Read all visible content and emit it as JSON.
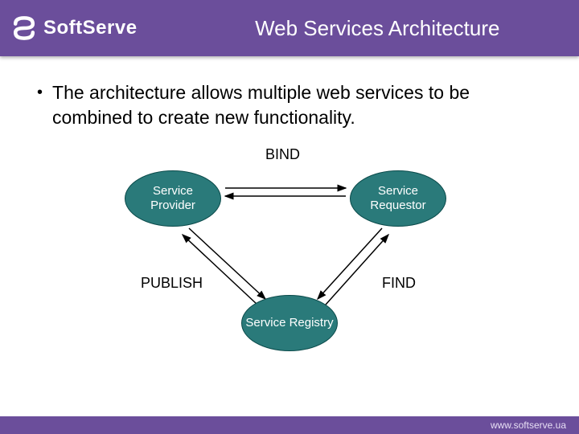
{
  "header": {
    "logo_text": "SoftServe",
    "title": "Web Services Architecture"
  },
  "content": {
    "bullet": "The architecture allows multiple web services to be combined to create new functionality."
  },
  "diagram": {
    "nodes": {
      "provider": "Service Provider",
      "requestor": "Service Requestor",
      "registry": "Service Registry"
    },
    "edges": {
      "bind": "BIND",
      "publish": "PUBLISH",
      "find": "FIND"
    }
  },
  "footer": {
    "url": "www.softserve.ua"
  },
  "colors": {
    "brand_purple": "#6b4e9b",
    "node_teal": "#2a7a7a"
  }
}
